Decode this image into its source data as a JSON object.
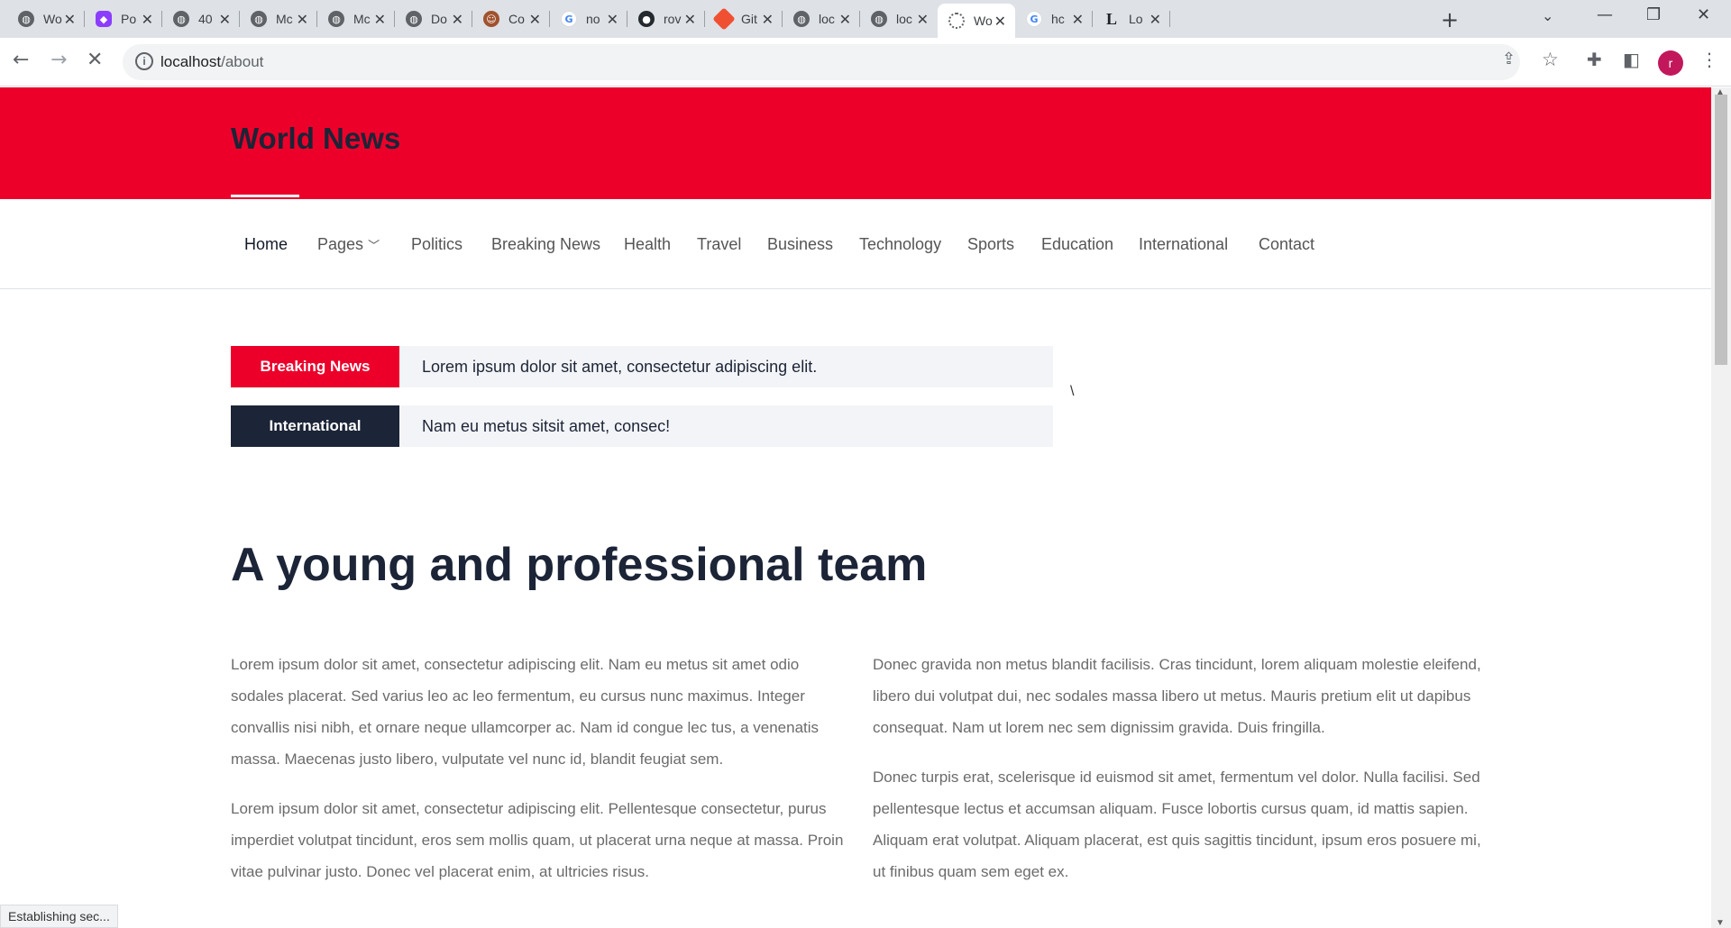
{
  "browser": {
    "tabs": [
      {
        "title": "Wo",
        "icon": "globe-icon"
      },
      {
        "title": "Po",
        "icon": "postman-icon"
      },
      {
        "title": "40",
        "icon": "globe-icon"
      },
      {
        "title": "Mc",
        "icon": "globe-icon"
      },
      {
        "title": "Mc",
        "icon": "globe-icon"
      },
      {
        "title": "Do",
        "icon": "globe-icon"
      },
      {
        "title": "Co",
        "icon": "avatar-icon"
      },
      {
        "title": "no",
        "icon": "google-icon"
      },
      {
        "title": "rov",
        "icon": "github-icon"
      },
      {
        "title": "Git",
        "icon": "git-icon"
      },
      {
        "title": "loc",
        "icon": "globe-icon"
      },
      {
        "title": "loc",
        "icon": "globe-icon"
      },
      {
        "title": "Wo",
        "icon": "loading-icon"
      },
      {
        "title": "hc",
        "icon": "google-icon"
      },
      {
        "title": "Lo",
        "icon": "l-icon"
      }
    ],
    "url_host": "localhost",
    "url_path": "/about",
    "profile_initial": "r",
    "status_text": "Establishing sec..."
  },
  "site": {
    "brand": "World News",
    "nav": [
      {
        "label": "Home",
        "active": true
      },
      {
        "label": "Pages",
        "dropdown": true
      },
      {
        "label": "Politics"
      },
      {
        "label": "Breaking News"
      },
      {
        "label": "Health"
      },
      {
        "label": "Travel"
      },
      {
        "label": "Business"
      },
      {
        "label": "Technology"
      },
      {
        "label": "Sports"
      },
      {
        "label": "Education"
      },
      {
        "label": "International"
      },
      {
        "label": "Contact"
      }
    ],
    "tickers": [
      {
        "label": "Breaking News",
        "text": "Lorem ipsum dolor sit amet, consectetur adipiscing elit.",
        "color": "#ec002a"
      },
      {
        "label": "International",
        "text": "Nam eu metus sitsit amet, consec!",
        "color": "#1c2437"
      }
    ],
    "stray_char": "\\",
    "heading": "A young and professional team",
    "left_paragraphs": [
      "Lorem ipsum dolor sit amet, consectetur adipiscing elit. Nam eu metus sit amet odio sodales placerat. Sed varius leo ac leo fermentum, eu cursus nunc maximus. Integer convallis nisi nibh, et ornare neque ullamcorper ac. Nam id congue lec tus, a venenatis massa. Maecenas justo libero, vulputate vel nunc id, blandit feugiat sem.",
      "Lorem ipsum dolor sit amet, consectetur adipiscing elit. Pellentesque consectetur, purus imperdiet volutpat tincidunt, eros sem mollis quam, ut placerat urna neque at massa. Proin vitae pulvinar justo. Donec vel placerat enim, at ultricies risus."
    ],
    "right_paragraphs": [
      "Donec gravida non metus blandit facilisis. Cras tincidunt, lorem aliquam molestie eleifend, libero dui volutpat dui, nec sodales massa libero ut metus. Mauris pretium elit ut dapibus consequat. Nam ut lorem nec sem dignissim gravida. Duis fringilla.",
      "Donec turpis erat, scelerisque id euismod sit amet, fermentum vel dolor. Nulla facilisi. Sed pellentesque lectus et accumsan aliquam. Fusce lobortis cursus quam, id mattis sapien. Aliquam erat volutpat. Aliquam placerat, est quis sagittis tincidunt, ipsum eros posuere mi, ut finibus quam sem eget ex."
    ],
    "colors": {
      "brand_red": "#ec002a",
      "navy": "#1c2437"
    }
  }
}
